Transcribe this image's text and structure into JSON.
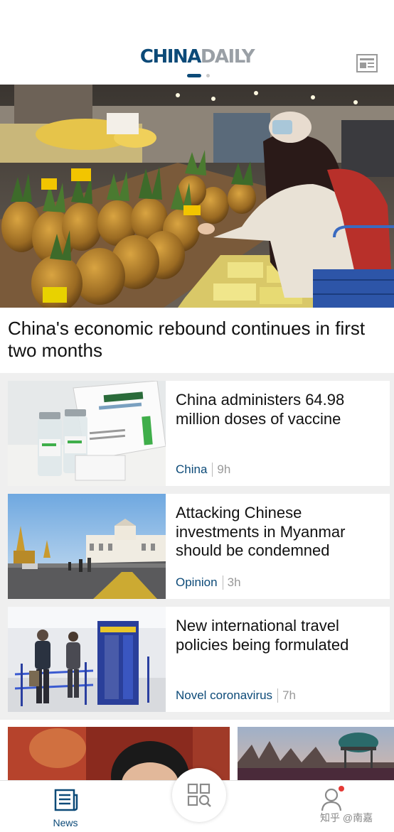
{
  "header": {
    "logo_part1": "CHINA",
    "logo_part2": "DAILY",
    "menu_icon": "newspaper-icon"
  },
  "hero": {
    "title": "China's economic rebound continues in first two months"
  },
  "articles": [
    {
      "title": "China administers 64.98 million doses of vaccine",
      "category": "China",
      "time": "9h"
    },
    {
      "title": "Attacking Chinese investments in Myanmar should be condemned",
      "category": "Opinion",
      "time": "3h"
    },
    {
      "title": "New international travel policies being formulated",
      "category": "Novel coronavirus",
      "time": "7h"
    }
  ],
  "tabbar": {
    "news_label": "News",
    "news_icon": "news-icon",
    "scan_icon": "grid-scan-icon",
    "profile_icon": "user-icon",
    "watermark": "知乎 @南嘉"
  },
  "colors": {
    "brand": "#0c4a78",
    "notification": "#e53935"
  }
}
